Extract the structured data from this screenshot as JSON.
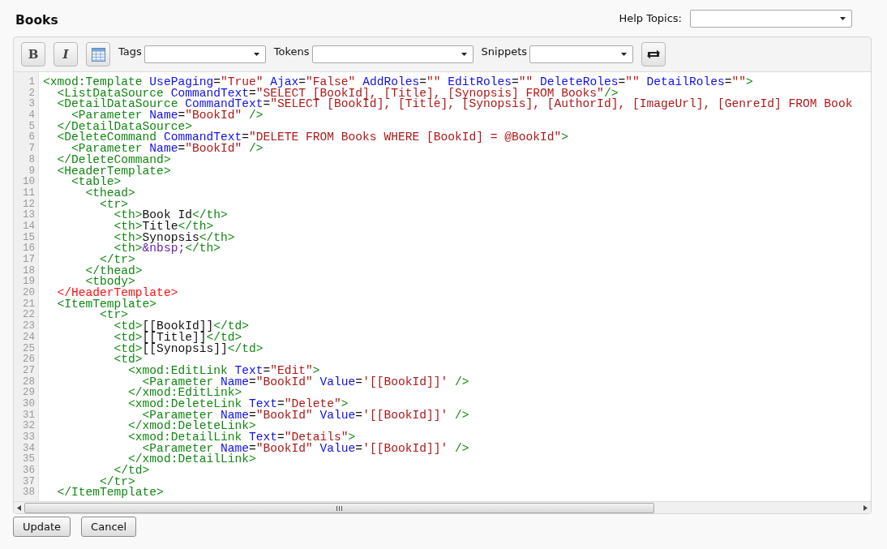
{
  "title": "Books",
  "help_topics": {
    "label": "Help Topics:"
  },
  "toolbar": {
    "buttons": [
      {
        "kind": "bold",
        "text": "B"
      },
      {
        "kind": "italic",
        "text": "I"
      },
      {
        "kind": "table"
      }
    ],
    "dropdowns": [
      {
        "label": "Tags"
      },
      {
        "label": "Tokens"
      },
      {
        "label": "Snippets"
      }
    ]
  },
  "code_lines": [
    {
      "number": "1",
      "tokens": [
        {
          "kind": "tag",
          "text": "<xmod:Template"
        },
        {
          "kind": "attr",
          "text": " UsePaging"
        },
        {
          "kind": "plain",
          "text": "="
        },
        {
          "kind": "value",
          "text": "\"True\""
        },
        {
          "kind": "attr",
          "text": " Ajax"
        },
        {
          "kind": "plain",
          "text": "="
        },
        {
          "kind": "value",
          "text": "\"False\""
        },
        {
          "kind": "attr",
          "text": " AddRoles"
        },
        {
          "kind": "plain",
          "text": "="
        },
        {
          "kind": "value",
          "text": "\"\""
        },
        {
          "kind": "attr",
          "text": " EditRoles"
        },
        {
          "kind": "plain",
          "text": "="
        },
        {
          "kind": "value",
          "text": "\"\""
        },
        {
          "kind": "attr",
          "text": " DeleteRoles"
        },
        {
          "kind": "plain",
          "text": "="
        },
        {
          "kind": "value",
          "text": "\"\""
        },
        {
          "kind": "attr",
          "text": " DetailRoles"
        },
        {
          "kind": "plain",
          "text": "="
        },
        {
          "kind": "value",
          "text": "\"\""
        },
        {
          "kind": "tag",
          "text": ">"
        }
      ]
    },
    {
      "number": "2",
      "tokens": [
        {
          "kind": "tag",
          "text": "  <ListDataSource"
        },
        {
          "kind": "attr",
          "text": " CommandText"
        },
        {
          "kind": "plain",
          "text": "="
        },
        {
          "kind": "value",
          "text": "\"SELECT [BookId], [Title], [Synopsis] FROM Books\""
        },
        {
          "kind": "tag",
          "text": "/>"
        }
      ]
    },
    {
      "number": "3",
      "tokens": [
        {
          "kind": "tag",
          "text": "  <DetailDataSource"
        },
        {
          "kind": "attr",
          "text": " CommandText"
        },
        {
          "kind": "plain",
          "text": "="
        },
        {
          "kind": "value",
          "text": "\"SELECT [BookId], [Title], [Synopsis], [AuthorId], [ImageUrl], [GenreId] FROM Book"
        }
      ]
    },
    {
      "number": "4",
      "tokens": [
        {
          "kind": "tag",
          "text": "    <Parameter"
        },
        {
          "kind": "attr",
          "text": " Name"
        },
        {
          "kind": "plain",
          "text": "="
        },
        {
          "kind": "value",
          "text": "\"BookId\""
        },
        {
          "kind": "tag",
          "text": " />"
        }
      ]
    },
    {
      "number": "5",
      "tokens": [
        {
          "kind": "tag",
          "text": "  </DetailDataSource>"
        }
      ]
    },
    {
      "number": "6",
      "tokens": [
        {
          "kind": "tag",
          "text": "  <DeleteCommand"
        },
        {
          "kind": "attr",
          "text": " CommandText"
        },
        {
          "kind": "plain",
          "text": "="
        },
        {
          "kind": "value",
          "text": "\"DELETE FROM Books WHERE [BookId] = @BookId\""
        },
        {
          "kind": "tag",
          "text": ">"
        }
      ]
    },
    {
      "number": "7",
      "tokens": [
        {
          "kind": "tag",
          "text": "    <Parameter"
        },
        {
          "kind": "attr",
          "text": " Name"
        },
        {
          "kind": "plain",
          "text": "="
        },
        {
          "kind": "value",
          "text": "\"BookId\""
        },
        {
          "kind": "tag",
          "text": " />"
        }
      ]
    },
    {
      "number": "8",
      "tokens": [
        {
          "kind": "tag",
          "text": "  </DeleteCommand>"
        }
      ]
    },
    {
      "number": "9",
      "tokens": [
        {
          "kind": "tag",
          "text": "  <HeaderTemplate>"
        }
      ]
    },
    {
      "number": "10",
      "tokens": [
        {
          "kind": "tag",
          "text": "    <table>"
        }
      ]
    },
    {
      "number": "11",
      "tokens": [
        {
          "kind": "tag",
          "text": "      <thead>"
        }
      ]
    },
    {
      "number": "12",
      "tokens": [
        {
          "kind": "tag",
          "text": "        <tr>"
        }
      ]
    },
    {
      "number": "13",
      "tokens": [
        {
          "kind": "tag",
          "text": "          <th>"
        },
        {
          "kind": "plain",
          "text": "Book Id"
        },
        {
          "kind": "tag",
          "text": "</th>"
        }
      ]
    },
    {
      "number": "14",
      "tokens": [
        {
          "kind": "tag",
          "text": "          <th>"
        },
        {
          "kind": "plain",
          "text": "Title"
        },
        {
          "kind": "tag",
          "text": "</th>"
        }
      ]
    },
    {
      "number": "15",
      "tokens": [
        {
          "kind": "tag",
          "text": "          <th>"
        },
        {
          "kind": "plain",
          "text": "Synopsis"
        },
        {
          "kind": "tag",
          "text": "</th>"
        }
      ]
    },
    {
      "number": "16",
      "tokens": [
        {
          "kind": "tag",
          "text": "          <th>"
        },
        {
          "kind": "entity",
          "text": "&nbsp;"
        },
        {
          "kind": "tag",
          "text": "</th>"
        }
      ]
    },
    {
      "number": "17",
      "tokens": [
        {
          "kind": "tag",
          "text": "        </tr>"
        }
      ]
    },
    {
      "number": "18",
      "tokens": [
        {
          "kind": "tag",
          "text": "      </thead>"
        }
      ]
    },
    {
      "number": "19",
      "tokens": [
        {
          "kind": "tag",
          "text": "      <tbody>"
        }
      ]
    },
    {
      "number": "20",
      "tokens": [
        {
          "kind": "error",
          "text": "  </HeaderTemplate>"
        }
      ]
    },
    {
      "number": "21",
      "tokens": [
        {
          "kind": "tag",
          "text": "  <ItemTemplate>"
        }
      ]
    },
    {
      "number": "22",
      "tokens": [
        {
          "kind": "tag",
          "text": "        <tr>"
        }
      ]
    },
    {
      "number": "23",
      "tokens": [
        {
          "kind": "tag",
          "text": "          <td>"
        },
        {
          "kind": "plain",
          "text": "[[BookId]]"
        },
        {
          "kind": "tag",
          "text": "</td>"
        }
      ]
    },
    {
      "number": "24",
      "tokens": [
        {
          "kind": "tag",
          "text": "          <td>"
        },
        {
          "kind": "plain",
          "text": "[[Title]]"
        },
        {
          "kind": "tag",
          "text": "</td>"
        }
      ]
    },
    {
      "number": "25",
      "tokens": [
        {
          "kind": "tag",
          "text": "          <td>"
        },
        {
          "kind": "plain",
          "text": "[[Synopsis]]"
        },
        {
          "kind": "tag",
          "text": "</td>"
        }
      ]
    },
    {
      "number": "26",
      "tokens": [
        {
          "kind": "tag",
          "text": "          <td>"
        }
      ]
    },
    {
      "number": "27",
      "tokens": [
        {
          "kind": "tag",
          "text": "            <xmod:EditLink"
        },
        {
          "kind": "attr",
          "text": " Text"
        },
        {
          "kind": "plain",
          "text": "="
        },
        {
          "kind": "value",
          "text": "\"Edit\""
        },
        {
          "kind": "tag",
          "text": ">"
        }
      ]
    },
    {
      "number": "28",
      "tokens": [
        {
          "kind": "tag",
          "text": "              <Parameter"
        },
        {
          "kind": "attr",
          "text": " Name"
        },
        {
          "kind": "plain",
          "text": "="
        },
        {
          "kind": "value",
          "text": "\"BookId\""
        },
        {
          "kind": "attr",
          "text": " Value"
        },
        {
          "kind": "plain",
          "text": "="
        },
        {
          "kind": "value",
          "text": "'[[BookId]]'"
        },
        {
          "kind": "tag",
          "text": " />"
        }
      ]
    },
    {
      "number": "29",
      "tokens": [
        {
          "kind": "tag",
          "text": "            </xmod:EditLink>"
        }
      ]
    },
    {
      "number": "30",
      "tokens": [
        {
          "kind": "tag",
          "text": "            <xmod:DeleteLink"
        },
        {
          "kind": "attr",
          "text": " Text"
        },
        {
          "kind": "plain",
          "text": "="
        },
        {
          "kind": "value",
          "text": "\"Delete\""
        },
        {
          "kind": "tag",
          "text": ">"
        }
      ]
    },
    {
      "number": "31",
      "tokens": [
        {
          "kind": "tag",
          "text": "              <Parameter"
        },
        {
          "kind": "attr",
          "text": " Name"
        },
        {
          "kind": "plain",
          "text": "="
        },
        {
          "kind": "value",
          "text": "\"BookId\""
        },
        {
          "kind": "attr",
          "text": " Value"
        },
        {
          "kind": "plain",
          "text": "="
        },
        {
          "kind": "value",
          "text": "'[[BookId]]'"
        },
        {
          "kind": "tag",
          "text": " />"
        }
      ]
    },
    {
      "number": "32",
      "tokens": [
        {
          "kind": "tag",
          "text": "            </xmod:DeleteLink>"
        }
      ]
    },
    {
      "number": "33",
      "tokens": [
        {
          "kind": "tag",
          "text": "            <xmod:DetailLink"
        },
        {
          "kind": "attr",
          "text": " Text"
        },
        {
          "kind": "plain",
          "text": "="
        },
        {
          "kind": "value",
          "text": "\"Details\""
        },
        {
          "kind": "tag",
          "text": ">"
        }
      ]
    },
    {
      "number": "34",
      "tokens": [
        {
          "kind": "tag",
          "text": "              <Parameter"
        },
        {
          "kind": "attr",
          "text": " Name"
        },
        {
          "kind": "plain",
          "text": "="
        },
        {
          "kind": "value",
          "text": "\"BookId\""
        },
        {
          "kind": "attr",
          "text": " Value"
        },
        {
          "kind": "plain",
          "text": "="
        },
        {
          "kind": "value",
          "text": "'[[BookId]]'"
        },
        {
          "kind": "tag",
          "text": " />"
        }
      ]
    },
    {
      "number": "35",
      "tokens": [
        {
          "kind": "tag",
          "text": "            </xmod:DetailLink>"
        }
      ]
    },
    {
      "number": "36",
      "tokens": [
        {
          "kind": "tag",
          "text": "          </td>"
        }
      ]
    },
    {
      "number": "37",
      "tokens": [
        {
          "kind": "tag",
          "text": "        </tr>"
        }
      ]
    },
    {
      "number": "38",
      "tokens": [
        {
          "kind": "tag",
          "text": "  </ItemTemplate>"
        }
      ]
    }
  ],
  "actions": [
    {
      "label": "Update"
    },
    {
      "label": "Cancel"
    }
  ]
}
